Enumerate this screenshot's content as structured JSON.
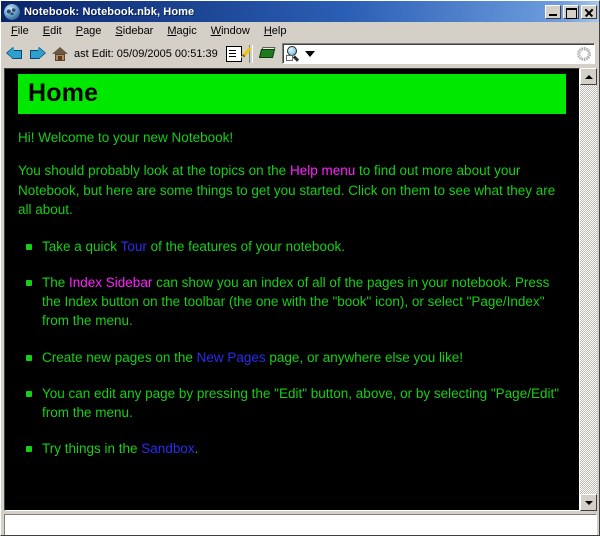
{
  "window": {
    "title": "Notebook: Notebook.nbk, Home",
    "icon": "notebook-globe-icon",
    "controls": {
      "minimize": "Minimize",
      "maximize": "Maximize",
      "close": "Close"
    }
  },
  "menubar": {
    "items": [
      {
        "label": "File",
        "accel": "F"
      },
      {
        "label": "Edit",
        "accel": "E"
      },
      {
        "label": "Page",
        "accel": "P"
      },
      {
        "label": "Sidebar",
        "accel": "S"
      },
      {
        "label": "Magic",
        "accel": "M"
      },
      {
        "label": "Window",
        "accel": "W"
      },
      {
        "label": "Help",
        "accel": "H"
      }
    ]
  },
  "toolbar": {
    "back_icon": "back-arrow-icon",
    "forward_icon": "forward-arrow-icon",
    "home_icon": "home-icon",
    "last_edit_label": "ast Edit: 05/09/2005 00:51:39",
    "edit_icon": "edit-page-icon",
    "index_icon": "index-book-icon",
    "search": {
      "icon": "magnifier-icon",
      "dropdown_icon": "chevron-down-icon",
      "value": "",
      "placeholder": "",
      "decoration_icon": "resize-grip-icon"
    }
  },
  "page": {
    "banner_title": "Home",
    "paragraphs": [
      {
        "segments": [
          {
            "text": "Hi! Welcome to your new Notebook!",
            "style": "text"
          }
        ]
      },
      {
        "segments": [
          {
            "text": "You should probably look at the topics on the ",
            "style": "text"
          },
          {
            "text": "Help menu",
            "style": "link-magenta"
          },
          {
            "text": " to find out more about your Notebook, but here are some things to get you started.  Click on them to see what they are all about.",
            "style": "text"
          }
        ]
      }
    ],
    "bullets": [
      {
        "segments": [
          {
            "text": "Take a quick ",
            "style": "text"
          },
          {
            "text": "Tour",
            "style": "link-blue"
          },
          {
            "text": " of the features of your notebook.",
            "style": "text"
          }
        ]
      },
      {
        "segments": [
          {
            "text": "The ",
            "style": "text"
          },
          {
            "text": "Index Sidebar",
            "style": "link-magenta"
          },
          {
            "text": " can show you an index of all of the pages in your notebook.  Press the Index button on the toolbar (the one with the \"book\" icon), or select \"Page/Index\" from the menu.",
            "style": "text"
          }
        ]
      },
      {
        "segments": [
          {
            "text": "Create new pages on the ",
            "style": "text"
          },
          {
            "text": "New Pages",
            "style": "link-blue"
          },
          {
            "text": " page, or anywhere else you like!",
            "style": "text"
          }
        ]
      },
      {
        "segments": [
          {
            "text": "You can edit any page by pressing the \"Edit\" button, above, or by selecting \"Page/Edit\" from the menu.",
            "style": "text"
          }
        ]
      },
      {
        "segments": [
          {
            "text": "Try things in the ",
            "style": "text"
          },
          {
            "text": "Sandbox",
            "style": "link-blue"
          },
          {
            "text": ".",
            "style": "text"
          }
        ]
      }
    ]
  },
  "scrollbar": {
    "up_icon": "scroll-up-icon",
    "down_icon": "scroll-down-icon"
  },
  "statusbar": {
    "text": ""
  },
  "colors": {
    "banner_green": "#00e800",
    "body_green": "#17cf17",
    "link_magenta": "#ff22ff",
    "link_blue": "#2b2bf0",
    "page_background": "#000000",
    "chrome": "#d4d0c8",
    "titlebar_blue": "#0a246a"
  }
}
